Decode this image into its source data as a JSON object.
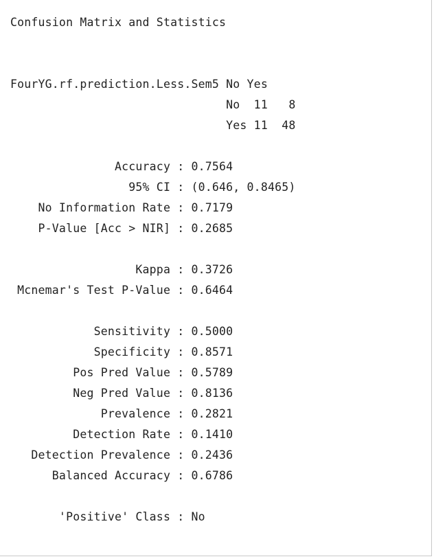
{
  "title": "Confusion Matrix and Statistics",
  "matrix": {
    "header": "FourYG.rf.prediction.Less.Sem5 No Yes",
    "row_no": "                               No  11   8",
    "row_yes": "                               Yes 11  48"
  },
  "stats_group_1": [
    "               Accuracy : 0.7564",
    "                 95% CI : (0.646, 0.8465)",
    "    No Information Rate : 0.7179",
    "    P-Value [Acc > NIR] : 0.2685"
  ],
  "stats_group_2": [
    "                  Kappa : 0.3726",
    " Mcnemar's Test P-Value : 0.6464"
  ],
  "stats_group_3": [
    "            Sensitivity : 0.5000",
    "            Specificity : 0.8571",
    "         Pos Pred Value : 0.5789",
    "         Neg Pred Value : 0.8136",
    "             Prevalence : 0.2821",
    "         Detection Rate : 0.1410",
    "   Detection Prevalence : 0.2436",
    "      Balanced Accuracy : 0.6786"
  ],
  "positive_class": "       'Positive' Class : No"
}
